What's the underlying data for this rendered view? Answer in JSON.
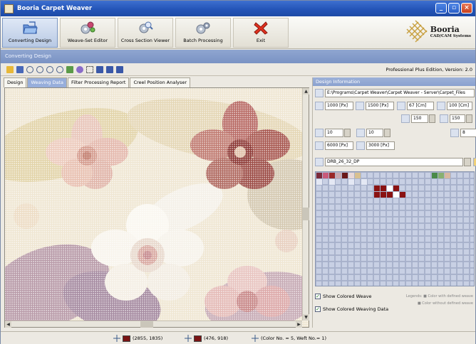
{
  "window": {
    "title": "Booria Carpet Weaver"
  },
  "big_toolbar": {
    "buttons": [
      {
        "label": "Converting Design"
      },
      {
        "label": "Weave-Set Editor"
      },
      {
        "label": "Cross Section Viewer"
      },
      {
        "label": "Batch Processing"
      },
      {
        "label": "Exit"
      }
    ],
    "logo": {
      "name": "Booria",
      "subtitle": "CAD/CAM Systems"
    }
  },
  "section": {
    "title": "Converting Design"
  },
  "toolbar": {
    "edition": "Professional Plus Edition, Version: 2.0"
  },
  "tabs": [
    "Design",
    "Weaving Data",
    "Filter Processing Report",
    "Creel Position Analyser"
  ],
  "selected_tab": "Weaving Data",
  "panel": {
    "title": "Design Information",
    "path": "E:\\Programs\\Carpet Weaver\\Carpet Weaver - Server\\Carpet_Files",
    "width_px": "1000 [Px]",
    "height_px": "1500 [Px]",
    "width_cm": "67 [Cm]",
    "height_cm": "100 [Cm]",
    "density_a": "150",
    "density_b": "150",
    "count_a": "10",
    "count_b": "10",
    "colors": "8",
    "total_a": "6000 [Px]",
    "total_b": "3000 [Px]",
    "weave_set": "DRB_26_32_DP",
    "show_colored_weave": "Show Colored Weave",
    "show_colored_weaving_data": "Show Colored Weaving Data",
    "legend_1": "Legends: ■ Color with defined weave",
    "legend_2": "■ Color without defined weave"
  },
  "status": {
    "pos1": "(2855, 1835)",
    "pos2": "(476, 918)",
    "info": "(Color No. = 5,  Weft No.= 1)",
    "swatch_color": "#7a1414"
  },
  "colors": {
    "accent": "#2455b8",
    "band": "#7a93c4",
    "selected_weave": "#8a1212"
  }
}
